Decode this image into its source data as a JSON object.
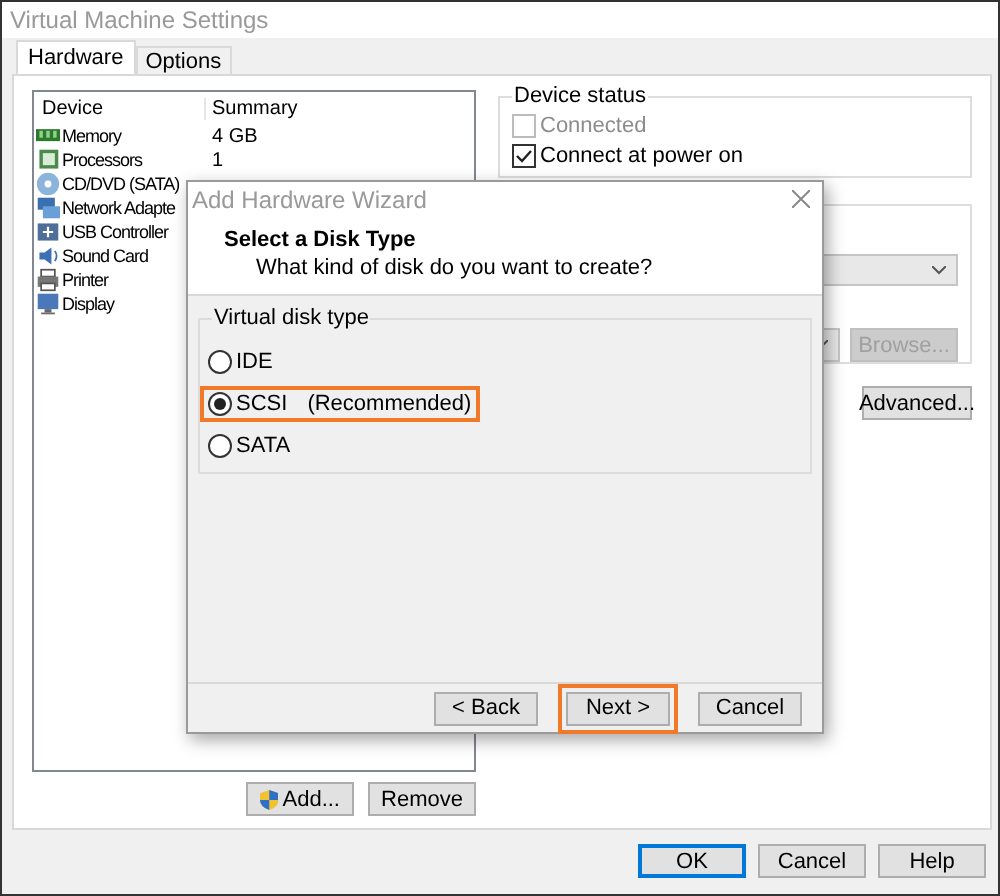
{
  "window": {
    "title": "Virtual Machine Settings"
  },
  "tabs": [
    {
      "label": "Hardware",
      "selected": true
    },
    {
      "label": "Options",
      "selected": false
    }
  ],
  "device_list": {
    "columns": [
      "Device",
      "Summary"
    ],
    "rows": [
      {
        "kind": "memory",
        "device": "Memory",
        "summary": "4 GB"
      },
      {
        "kind": "processor",
        "device": "Processors",
        "summary": "1"
      },
      {
        "kind": "disc",
        "device": "CD/DVD (SATA)"
      },
      {
        "kind": "network",
        "device": "Network Adapte"
      },
      {
        "kind": "usb",
        "device": "USB Controller"
      },
      {
        "kind": "sound",
        "device": "Sound Card"
      },
      {
        "kind": "printer",
        "device": "Printer"
      },
      {
        "kind": "display",
        "device": "Display"
      }
    ]
  },
  "list_buttons": [
    "Add...",
    "Remove"
  ],
  "device_status": {
    "title": "Device status",
    "options": [
      {
        "label": "Connected",
        "checked": false,
        "disabled": true
      },
      {
        "label": "Connect at power on",
        "checked": true,
        "disabled": false
      }
    ]
  },
  "browse_button": {
    "label": "Browse...",
    "disabled": true
  },
  "advanced_button": "Advanced...",
  "dialog_buttons": [
    {
      "label": "OK",
      "default": true
    },
    {
      "label": "Cancel",
      "default": false
    },
    {
      "label": "Help",
      "default": false
    }
  ],
  "wizard": {
    "title": "Add Hardware Wizard",
    "heading": "Select a Disk Type",
    "subheading": "What kind of disk do you want to create?",
    "group_title": "Virtual disk type",
    "options": [
      {
        "label": "IDE",
        "selected": false,
        "highlighted": false
      },
      {
        "label": "SCSI",
        "note": "(Recommended)",
        "selected": true,
        "highlighted": true
      },
      {
        "label": "SATA",
        "selected": false,
        "highlighted": false
      }
    ],
    "buttons": [
      {
        "label": "< Back",
        "highlighted": false
      },
      {
        "label": "Next >",
        "highlighted": true
      },
      {
        "label": "Cancel",
        "highlighted": false
      }
    ]
  }
}
